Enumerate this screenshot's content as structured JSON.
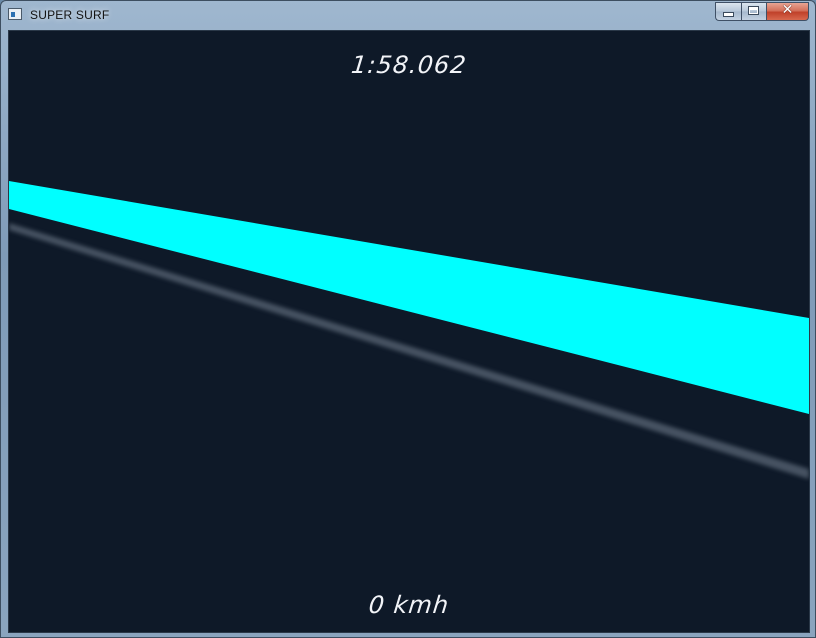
{
  "window": {
    "title": "SUPER SURF",
    "icon": "app-window-icon",
    "close_glyph": "✕"
  },
  "hud": {
    "timer": "1:58.062",
    "speed": "0 kmh"
  },
  "colors": {
    "background": "#0e1928",
    "track": "#00ffff",
    "rail": "#5a6676",
    "hud_text": "#f2f4f8"
  }
}
